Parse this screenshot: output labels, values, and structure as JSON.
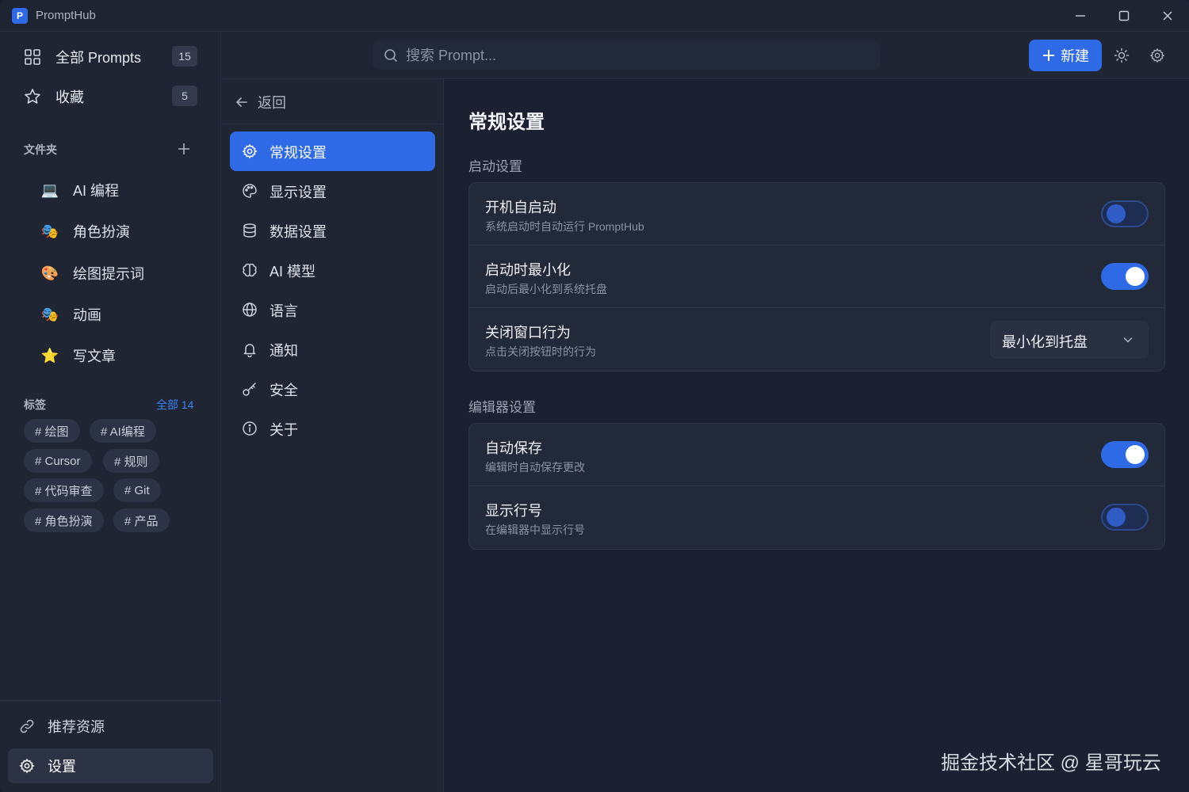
{
  "app": {
    "title": "PromptHub",
    "logo_letter": "P"
  },
  "sidebar": {
    "all_prompts": {
      "label": "全部 Prompts",
      "count": "15",
      "icon": "grid-icon"
    },
    "favorites": {
      "label": "收藏",
      "count": "5",
      "icon": "star-outline-icon"
    },
    "folders_title": "文件夹",
    "folders": [
      {
        "emoji": "💻",
        "label": "AI 编程"
      },
      {
        "emoji": "🎭",
        "label": "角色扮演"
      },
      {
        "emoji": "🎨",
        "label": "绘图提示词"
      },
      {
        "emoji": "🎭",
        "label": "动画"
      },
      {
        "emoji": "⭐",
        "label": "写文章"
      }
    ],
    "tags_title": "标签",
    "tags_all": "全部 14",
    "tags": [
      "# 绘图",
      "# AI编程",
      "# Cursor",
      "# 规则",
      "# 代码审查",
      "# Git",
      "# 角色扮演",
      "# 产品"
    ],
    "resources_label": "推荐资源",
    "settings_label": "设置"
  },
  "topbar": {
    "search_placeholder": "搜索 Prompt...",
    "new_button": "新建"
  },
  "settings_nav": {
    "back_label": "返回",
    "items": [
      {
        "label": "常规设置",
        "icon": "gear-icon",
        "active": true
      },
      {
        "label": "显示设置",
        "icon": "palette-icon"
      },
      {
        "label": "数据设置",
        "icon": "database-icon"
      },
      {
        "label": "AI 模型",
        "icon": "brain-icon"
      },
      {
        "label": "语言",
        "icon": "globe-icon"
      },
      {
        "label": "通知",
        "icon": "bell-icon"
      },
      {
        "label": "安全",
        "icon": "key-icon"
      },
      {
        "label": "关于",
        "icon": "info-icon"
      }
    ]
  },
  "content": {
    "title": "常规设置",
    "startup": {
      "title": "启动设置",
      "rows": [
        {
          "name": "开机自启动",
          "desc": "系统启动时自动运行 PromptHub",
          "enabled": false
        },
        {
          "name": "启动时最小化",
          "desc": "启动后最小化到系统托盘",
          "enabled": true
        },
        {
          "name": "关闭窗口行为",
          "desc": "点击关闭按钮时的行为",
          "value": "最小化到托盘"
        }
      ]
    },
    "editor": {
      "title": "编辑器设置",
      "rows": [
        {
          "name": "自动保存",
          "desc": "编辑时自动保存更改",
          "enabled": true
        },
        {
          "name": "显示行号",
          "desc": "在编辑器中显示行号",
          "enabled": false
        }
      ]
    }
  },
  "watermark": "掘金技术社区 @ 星哥玩云",
  "colors": {
    "accent": "#2e6ae6",
    "background": "#1b2130",
    "panel": "#1f2533"
  }
}
